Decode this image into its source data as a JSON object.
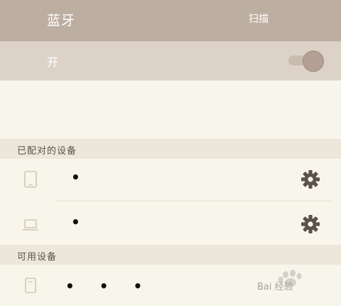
{
  "header": {
    "title": "蓝牙",
    "scan_label": "扫描"
  },
  "bluetooth_toggle": {
    "label": "开",
    "on": true
  },
  "paired_section": {
    "title": "已配对的设备",
    "devices": [
      {
        "name": "•",
        "icon": "phone-icon"
      },
      {
        "name": "•",
        "icon": "laptop-icon"
      }
    ]
  },
  "available_section": {
    "title": "可用设备",
    "devices": [
      {
        "name": "• • •",
        "icon": "device-icon"
      }
    ]
  },
  "watermark": {
    "text": "Bai 经验"
  },
  "colors": {
    "header_bg": "#bdaea2",
    "toggle_bg": "#dcd2c7",
    "page_bg": "#f8f5ea",
    "section_bg": "#ede6db"
  }
}
